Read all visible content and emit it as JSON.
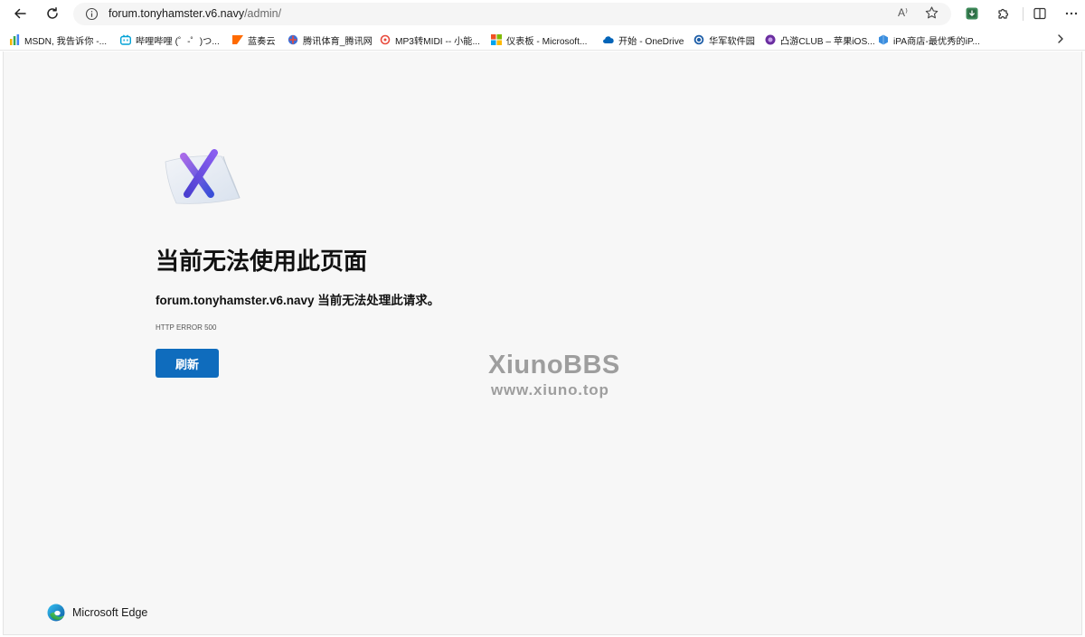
{
  "browser": {
    "address_bar": {
      "host": "forum.tonyhamster.v6.navy",
      "path": "/admin/",
      "read_aloud_label": "A⁾"
    },
    "toolbar_icons": [
      "back-icon",
      "refresh-icon",
      "site-info-icon",
      "read-aloud-icon",
      "favorite-star-icon",
      "extension-download-icon",
      "extensions-puzzle-icon",
      "split-screen-icon",
      "more-menu-icon"
    ]
  },
  "bookmarks": [
    {
      "label": "MSDN, 我告诉你 -...",
      "icon": "msdn-favicon",
      "color": "#f4b400"
    },
    {
      "label": "哔哩哔哩 (゜-゜)つ...",
      "icon": "bilibili-favicon",
      "color": "#00a1d6"
    },
    {
      "label": "蓝奏云",
      "icon": "lanzou-favicon",
      "color": "#ff6a00"
    },
    {
      "label": "腾讯体育_腾讯网",
      "icon": "tencent-sports-favicon",
      "color": "#3b6fd8"
    },
    {
      "label": "MP3转MIDI -- 小能...",
      "icon": "mp3-midi-favicon",
      "color": "#e84a3c"
    },
    {
      "label": "仪表板 - Microsoft...",
      "icon": "microsoft-favicon",
      "color": "#00a4ef"
    },
    {
      "label": "开始 - OneDrive",
      "icon": "onedrive-favicon",
      "color": "#0364b8"
    },
    {
      "label": "华军软件园",
      "icon": "huajun-favicon",
      "color": "#1f5fa8"
    },
    {
      "label": "凸游CLUB – 苹果iOS...",
      "icon": "tuyou-favicon",
      "color": "#6b2fa0"
    },
    {
      "label": "iPA商店-最优秀的iP...",
      "icon": "ipa-store-favicon",
      "color": "#3a8dde"
    }
  ],
  "page": {
    "title": "当前无法使用此页面",
    "description": "forum.tonyhamster.v6.navy 当前无法处理此请求。",
    "error_code": "HTTP ERROR 500",
    "refresh_label": "刷新",
    "watermark_line1": "XiunoBBS",
    "watermark_line2": "www.xiuno.top",
    "brand_name": "Microsoft Edge"
  },
  "colors": {
    "accent": "#0f6cbd",
    "page_background": "#f7f7f7"
  }
}
